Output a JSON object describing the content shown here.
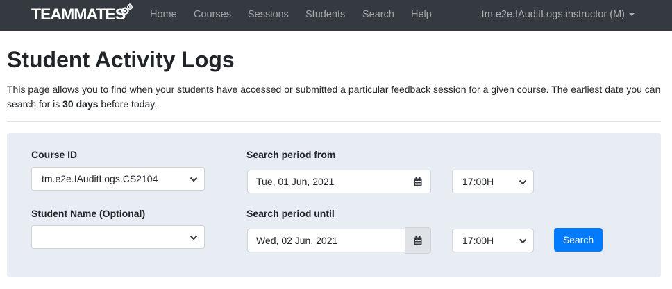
{
  "navbar": {
    "brand": "TEAMMATES",
    "links": [
      "Home",
      "Courses",
      "Sessions",
      "Students",
      "Search",
      "Help"
    ],
    "user": "tm.e2e.IAuditLogs.instructor (M)"
  },
  "header": {
    "title": "Student Activity Logs",
    "description_prefix": "This page allows you to find when your students have accessed or submitted a particular feedback session for a given course. The earliest date you can search for is ",
    "description_bold": "30 days",
    "description_suffix": " before today."
  },
  "form": {
    "course_label": "Course ID",
    "course_value": "tm.e2e.IAuditLogs.CS2104",
    "student_label": "Student Name (Optional)",
    "student_value": "",
    "from_label": "Search period from",
    "from_date": "Tue, 01 Jun, 2021",
    "from_time": "17:00H",
    "until_label": "Search period until",
    "until_date": "Wed, 02 Jun, 2021",
    "until_time": "17:00H",
    "search_label": "Search"
  },
  "icons": {
    "calendar": "calendar-icon",
    "dropdown": "chevron-down-icon",
    "logo_gear": "gear-icon"
  },
  "colors": {
    "navbar_bg": "#343a40",
    "panel_bg": "#e8edf3",
    "primary": "#007bff"
  }
}
